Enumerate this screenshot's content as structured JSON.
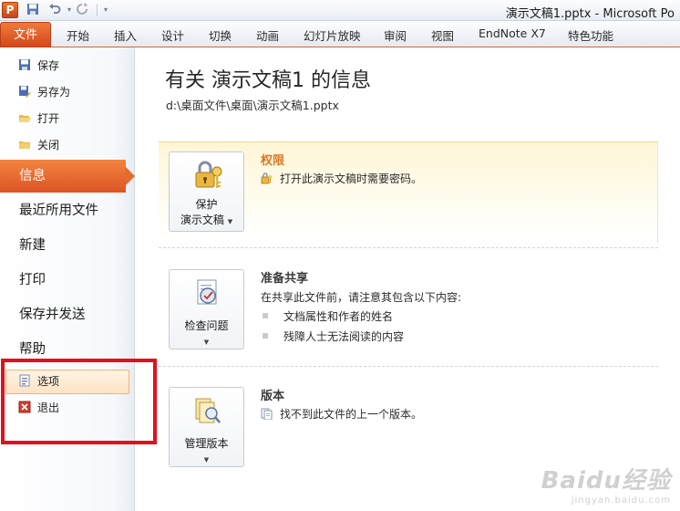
{
  "window": {
    "title": "演示文稿1.pptx - Microsoft Po",
    "app_icon_letter": "P"
  },
  "ribbon": {
    "file_tab": "文件",
    "tabs": [
      "开始",
      "插入",
      "设计",
      "切换",
      "动画",
      "幻灯片放映",
      "审阅",
      "视图",
      "EndNote X7",
      "特色功能"
    ]
  },
  "nav": {
    "save": "保存",
    "save_as": "另存为",
    "open": "打开",
    "close": "关闭",
    "info": "信息",
    "recent": "最近所用文件",
    "new": "新建",
    "print": "打印",
    "save_send": "保存并发送",
    "help": "帮助",
    "options": "选项",
    "exit": "退出"
  },
  "main": {
    "title": "有关 演示文稿1 的信息",
    "path": "d:\\桌面文件\\桌面\\演示文稿1.pptx",
    "permissions": {
      "button_line1": "保护",
      "button_line2": "演示文稿",
      "title": "权限",
      "text": "打开此演示文稿时需要密码。"
    },
    "prepare": {
      "button_label": "检查问题",
      "title": "准备共享",
      "text": "在共享此文件前，请注意其包含以下内容:",
      "bullets": [
        "文档属性和作者的姓名",
        "残障人士无法阅读的内容"
      ]
    },
    "versions": {
      "button_label": "管理版本",
      "title": "版本",
      "text": "找不到此文件的上一个版本。"
    }
  },
  "watermark": {
    "brand": "Baidu经验",
    "sub": "jingyan.baidu.com"
  },
  "colors": {
    "accent": "#e46a30",
    "highlight_frame": "#e2101b",
    "section_title": "#e0741f"
  }
}
